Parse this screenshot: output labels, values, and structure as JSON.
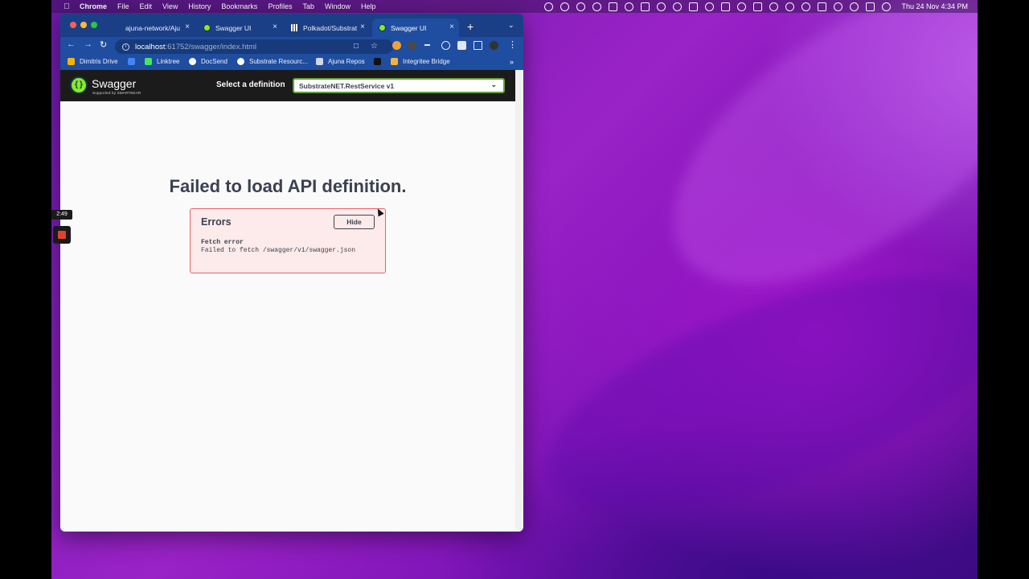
{
  "menubar": {
    "app": "Chrome",
    "items": [
      "File",
      "Edit",
      "View",
      "History",
      "Bookmarks",
      "Profiles",
      "Tab",
      "Window",
      "Help"
    ],
    "clock": "Thu 24 Nov  4:34 PM"
  },
  "browser": {
    "tabs": [
      {
        "label": "ajuna-network/Aju",
        "icon": "github-icon"
      },
      {
        "label": "Swagger UI",
        "icon": "swagger-icon"
      },
      {
        "label": "Polkadot/Substrat",
        "icon": "polkadot-icon"
      },
      {
        "label": "Swagger UI",
        "icon": "swagger-icon",
        "active": true
      }
    ],
    "url_host": "localhost",
    "url_rest": ":61752/swagger/index.html",
    "bookmarks": [
      {
        "label": "Dimitris Drive",
        "icon": "drive-icon",
        "color": "#f5b400"
      },
      {
        "label": "",
        "icon": "calendar-icon",
        "color": "#4285f4"
      },
      {
        "label": "Linktree",
        "icon": "linktree-icon",
        "color": "#43e660"
      },
      {
        "label": "DocSend",
        "icon": "docsend-icon",
        "color": "#ffffff"
      },
      {
        "label": "Substrate Resourc...",
        "icon": "github-icon",
        "color": "#ffffff"
      },
      {
        "label": "Ajuna Repos",
        "icon": "folder-icon",
        "color": "#d0d8ea"
      },
      {
        "label": "",
        "icon": "notion-icon",
        "color": "#111111"
      },
      {
        "label": "Integritee Bridge",
        "icon": "bridge-icon",
        "color": "#f0b43c"
      }
    ]
  },
  "swagger": {
    "brand": "Swagger",
    "brand_sub": "Supported by SMARTBEAR",
    "definition_label": "Select a definition",
    "definition_value": "SubstrateNET.RestService v1",
    "fail_title": "Failed to load API definition.",
    "errors_title": "Errors",
    "hide_label": "Hide",
    "error_head": "Fetch error",
    "error_message": "Failed to fetch /swagger/v1/swagger.json"
  },
  "recorder": {
    "timer": "2:49"
  },
  "colors": {
    "swagger_green": "#85ea2d",
    "error_bg": "#fdeaea",
    "error_border": "#e4646b",
    "chrome_blue": "#1f4d9f"
  }
}
